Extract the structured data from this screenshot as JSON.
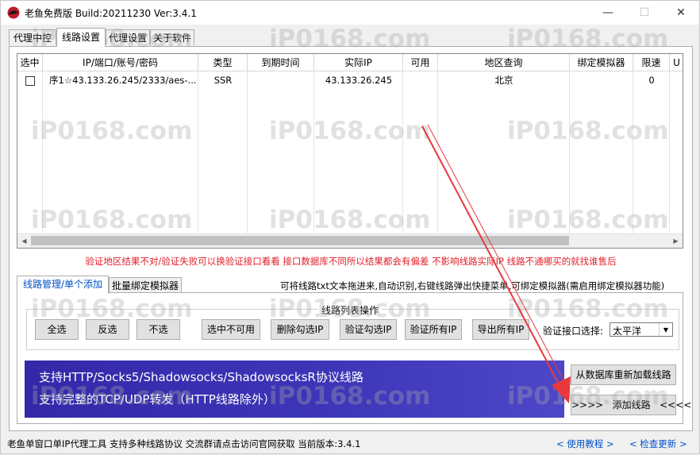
{
  "window": {
    "title": "老鱼免费版 Build:20211230 Ver:3.4.1",
    "minimize": "—",
    "maximize": "☐",
    "close": "✕"
  },
  "tabs_top": [
    {
      "label": "代理中控"
    },
    {
      "label": "线路设置"
    },
    {
      "label": "代理设置"
    },
    {
      "label": "关于软件"
    }
  ],
  "table": {
    "headers": [
      "选中",
      "IP/端口/账号/密码",
      "类型",
      "到期时间",
      "实际IP",
      "可用",
      "地区查询",
      "绑定模拟器",
      "限速",
      "U"
    ],
    "rows": [
      {
        "checked": false,
        "ip": "序1☆43.133.26.245/2333/aes-...",
        "type": "SSR",
        "expire": "",
        "real_ip": "43.133.26.245",
        "available": "",
        "region": "北京",
        "emulator": "",
        "limit": "0",
        "u": ""
      }
    ]
  },
  "warning": "验证地区结果不对/验证失败可以换验证接口看看 接口数据库不同所以结果都会有偏差 不影响线路实际IP 线路不通哪买的就找谁售后",
  "tabs_mid": [
    {
      "label": "线路管理/单个添加"
    },
    {
      "label": "批量绑定模拟器"
    }
  ],
  "hint": "可将线路txt文本拖进来,自动识别,右键线路弹出快捷菜单,可绑定模拟器(需启用绑定模拟器功能)",
  "group_title": "线路列表操作",
  "buttons": {
    "select_all": "全选",
    "invert": "反选",
    "select_none": "不选",
    "select_unavailable": "选中不可用",
    "delete_checked": "删除勾选IP",
    "verify_checked": "验证勾选IP",
    "verify_all": "验证所有IP",
    "export_all": "导出所有IP",
    "reload_db": "从数据库重新加载线路",
    "add_line": ">>>>   添加线路   <<<<"
  },
  "verify_api": {
    "label": "验证接口选择:",
    "value": "太平洋"
  },
  "banner": {
    "line1": "支持HTTP/Socks5/Shadowsocks/ShadowsocksR协议线路",
    "line2": "支持完整的TCP/UDP转发（HTTP线路除外）"
  },
  "status": {
    "text": "老鱼单窗口单IP代理工具 支持多种线路协议 交流群请点击访问官网获取  当前版本:3.4.1",
    "tutorial": "< 使用教程 >",
    "update": "< 检查更新 >"
  },
  "watermark": "iP0168.com",
  "colors": {
    "warning": "#e0202a",
    "link": "#0050c8",
    "banner": "#3d35b8",
    "annotation_arrow": "#e8393c"
  }
}
